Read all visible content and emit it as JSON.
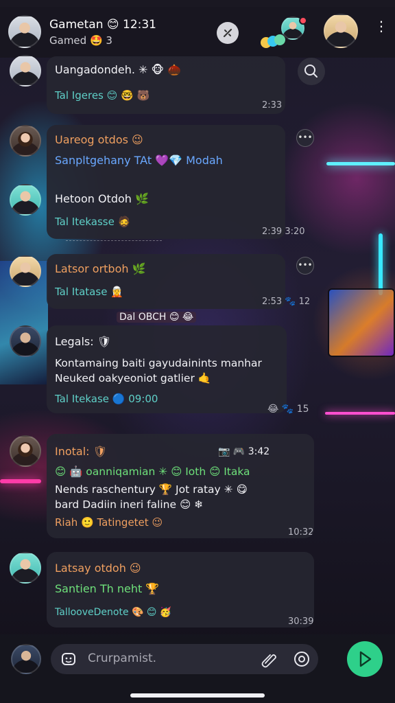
{
  "header": {
    "title": "Gametan 😊 12:31",
    "subtitle": "Gamed 🤩 3",
    "action_icon": "mute-icon",
    "menu_glyph": "⋮"
  },
  "messages": [
    {
      "lines": [
        {
          "text": "Uangadondeh. ✳ 🐵 🌰",
          "color": "white"
        },
        {
          "text": "Tal Igeres 😊 🤓 🐻",
          "color": "teal"
        }
      ],
      "time": "2:33"
    },
    {
      "lines": [
        {
          "text": "Uareog otdos 😉",
          "color": "orange"
        },
        {
          "text": "Sanpltgehany TAt 💜💎 Modah",
          "color": "blue"
        },
        {
          "text": "Hetoon Otdoh 🌿",
          "color": "white"
        },
        {
          "text": "Tal Itekasse 🧔",
          "color": "teal"
        }
      ],
      "time": "2:39 3:20"
    },
    {
      "lines": [
        {
          "text": "Latsor ortboh 🌿",
          "color": "orange"
        },
        {
          "text": "Tal Itatase 🧝",
          "color": "teal"
        }
      ],
      "time": "2:53 🐾 12",
      "floating": "Dal OBCH 😊 😂"
    },
    {
      "lines": [
        {
          "text": "Legals: 🛡",
          "color": "white"
        },
        {
          "text": "Kontamaing baiti gayudainints manhar",
          "color": "white"
        },
        {
          "text": "Neuked oakyeoniot gatlier 🤙",
          "color": "white"
        },
        {
          "text": "Tal Itekase 🔵 09:00",
          "color": "teal"
        }
      ],
      "time": "😂 🐾 15"
    },
    {
      "lines": [
        {
          "text": "Inotal: 🛡",
          "color": "orange"
        },
        {
          "text": "😊 🤖 oanniqamian ✳ 😊 Ioth 😊 Itaka",
          "color": "green"
        },
        {
          "text": "Nends raschentury 🏆 Jot ratay ✳ 😋",
          "color": "white"
        },
        {
          "text": "bard Dadiin ineri faline 😊 ❄",
          "color": "white"
        },
        {
          "text": "Riah 🙂 Tatingetet 😉",
          "color": "orange"
        }
      ],
      "header_right": "📷 🎮 3:42",
      "time": "10:32"
    },
    {
      "lines": [
        {
          "text": "Latsay otdoh 😉",
          "color": "orange"
        },
        {
          "text": "Santien Th neht 🏆",
          "color": "green"
        },
        {
          "text": "TallooveDenote 🎨 😊 🥳",
          "color": "teal"
        }
      ],
      "time": "30:39"
    }
  ],
  "composer": {
    "placeholder": "Crurpamist.",
    "emoji_icon": "emoji-icon",
    "attach_icon": "paperclip-icon",
    "camera_icon": "camera-icon",
    "send_icon": "send-icon"
  },
  "colors": {
    "accent": "#2ed08a",
    "bubble": "#262630",
    "orange": "#f0a060",
    "blue": "#6aa8ff",
    "teal": "#5fd0c8",
    "green": "#6ee07a"
  }
}
